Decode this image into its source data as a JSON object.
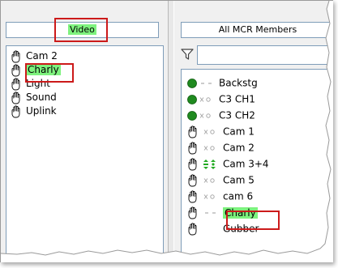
{
  "left_panel": {
    "header": "Video",
    "items": [
      {
        "label": "Cam 2",
        "highlighted": false
      },
      {
        "label": "Charly",
        "highlighted": true
      },
      {
        "label": "Light",
        "highlighted": false
      },
      {
        "label": "Sound",
        "highlighted": false
      },
      {
        "label": "Uplink",
        "highlighted": false
      }
    ]
  },
  "right_panel": {
    "header": "All MCR Members",
    "filter_value": "",
    "members": [
      {
        "icon": "status-dot-icon",
        "switch": "dash",
        "label": "Backstg"
      },
      {
        "icon": "status-dot-icon",
        "switch": "off",
        "label": "C3  CH1"
      },
      {
        "icon": "status-dot-icon",
        "switch": "off",
        "label": "C3  CH2"
      },
      {
        "icon": "hand-icon",
        "switch": "off",
        "label": "Cam 1"
      },
      {
        "icon": "hand-icon",
        "switch": "off",
        "label": "Cam 2"
      },
      {
        "icon": "hand-icon",
        "switch": "on",
        "label": "Cam 3+4"
      },
      {
        "icon": "hand-icon",
        "switch": "off",
        "label": "Cam 5"
      },
      {
        "icon": "hand-icon",
        "switch": "off",
        "label": "cam 6"
      },
      {
        "icon": "hand-icon",
        "switch": "dash",
        "label": "Charly"
      },
      {
        "icon": "hand-icon",
        "switch": "none",
        "label": "Gubber"
      }
    ]
  },
  "colors": {
    "highlight": "#7ef27e",
    "selection_border": "#cc1a1a",
    "status_dot": "#1f8a1f",
    "switch_on": "#22aa22"
  }
}
